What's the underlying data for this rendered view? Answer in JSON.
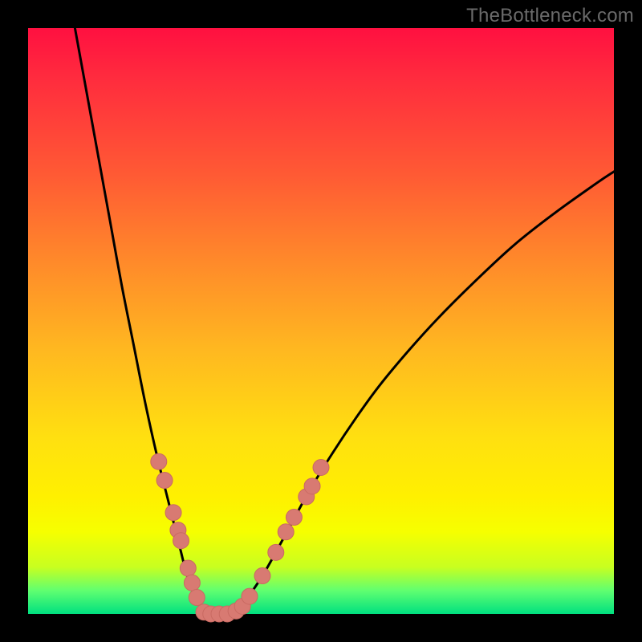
{
  "watermark": "TheBottleneck.com",
  "colors": {
    "background": "#000000",
    "curve": "#000000",
    "marker_fill": "#d87a72",
    "marker_stroke": "#c96a62",
    "gradient_top": "#ff1040",
    "gradient_bottom": "#00e080"
  },
  "chart_data": {
    "type": "line",
    "title": "",
    "xlabel": "",
    "ylabel": "",
    "xlim": [
      0,
      100
    ],
    "ylim": [
      0,
      100
    ],
    "series": [
      {
        "name": "left-curve",
        "x": [
          8,
          10,
          12,
          14,
          16,
          18,
          20,
          22,
          24,
          26,
          27,
          28,
          29,
          30,
          30.5
        ],
        "y": [
          100,
          89,
          78,
          67,
          56,
          46,
          36,
          27,
          19,
          11,
          7,
          4,
          2,
          0.5,
          0
        ]
      },
      {
        "name": "valley-floor",
        "x": [
          30.5,
          31,
          32,
          33,
          34,
          35
        ],
        "y": [
          0,
          0,
          0,
          0,
          0,
          0
        ]
      },
      {
        "name": "right-curve",
        "x": [
          35,
          36,
          37,
          38,
          40,
          42,
          45,
          48,
          52,
          56,
          60,
          65,
          70,
          76,
          83,
          90,
          97,
          100
        ],
        "y": [
          0,
          1,
          2.2,
          3.5,
          6.5,
          10,
          15.5,
          21,
          27.5,
          33.5,
          39,
          45,
          50.5,
          56.5,
          63,
          68.5,
          73.5,
          75.5
        ]
      }
    ],
    "markers": {
      "name": "highlight-points",
      "points": [
        {
          "x": 22.3,
          "y": 26.0
        },
        {
          "x": 23.3,
          "y": 22.8
        },
        {
          "x": 24.8,
          "y": 17.3
        },
        {
          "x": 25.6,
          "y": 14.3
        },
        {
          "x": 26.1,
          "y": 12.5
        },
        {
          "x": 27.3,
          "y": 7.8
        },
        {
          "x": 28.0,
          "y": 5.3
        },
        {
          "x": 28.8,
          "y": 2.8
        },
        {
          "x": 30.0,
          "y": 0.3
        },
        {
          "x": 31.2,
          "y": 0.0
        },
        {
          "x": 32.6,
          "y": 0.0
        },
        {
          "x": 34.0,
          "y": 0.0
        },
        {
          "x": 35.5,
          "y": 0.5
        },
        {
          "x": 36.6,
          "y": 1.3
        },
        {
          "x": 37.8,
          "y": 3.0
        },
        {
          "x": 40.0,
          "y": 6.5
        },
        {
          "x": 42.3,
          "y": 10.5
        },
        {
          "x": 44.0,
          "y": 14.0
        },
        {
          "x": 45.4,
          "y": 16.5
        },
        {
          "x": 47.5,
          "y": 20.0
        },
        {
          "x": 48.5,
          "y": 21.8
        },
        {
          "x": 50.0,
          "y": 25.0
        }
      ]
    }
  }
}
